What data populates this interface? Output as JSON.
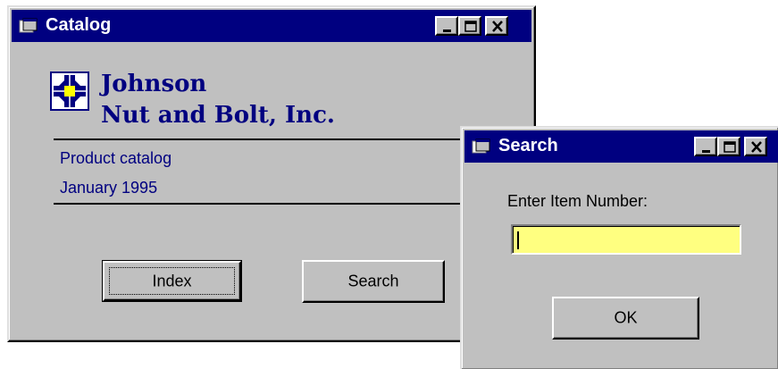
{
  "catalog_window": {
    "title": "Catalog",
    "company_line1": "Johnson",
    "company_line2": "Nut and Bolt, Inc.",
    "subtitle_line1": "Product catalog",
    "subtitle_line2": "January 1995",
    "index_label": "Index",
    "search_label": "Search"
  },
  "search_dialog": {
    "title": "Search",
    "prompt": "Enter Item Number:",
    "item_number_value": "",
    "ok_label": "OK"
  },
  "colors": {
    "titlebar": "#000080",
    "face": "#c0c0c0",
    "text_blue": "#000080",
    "input_yellow": "#ffff80"
  },
  "icons": [
    "app-window-icon",
    "minimize-icon",
    "maximize-icon",
    "close-icon",
    "company-logo"
  ]
}
